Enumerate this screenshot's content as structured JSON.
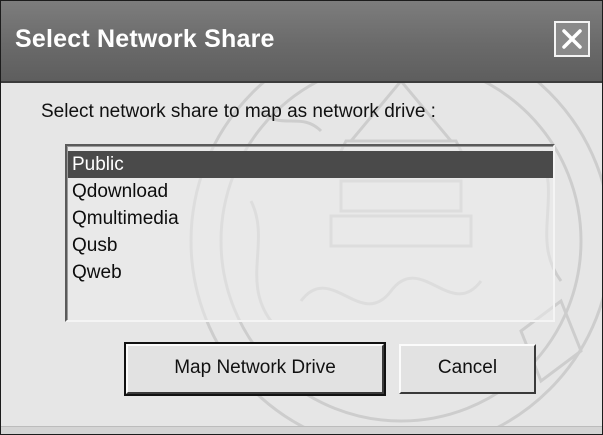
{
  "dialog": {
    "title": "Select Network Share",
    "prompt": "Select network share to map as network drive :",
    "close_icon": "close-icon"
  },
  "shares": {
    "items": [
      {
        "label": "Public",
        "selected": true
      },
      {
        "label": "Qdownload",
        "selected": false
      },
      {
        "label": "Qmultimedia",
        "selected": false
      },
      {
        "label": "Qusb",
        "selected": false
      },
      {
        "label": "Qweb",
        "selected": false
      }
    ]
  },
  "buttons": {
    "map_label": "Map Network Drive",
    "cancel_label": "Cancel"
  },
  "colors": {
    "titlebar": "#6a6a6a",
    "selection": "#4a4a4a",
    "dialog_bg": "#e6e6e6"
  }
}
